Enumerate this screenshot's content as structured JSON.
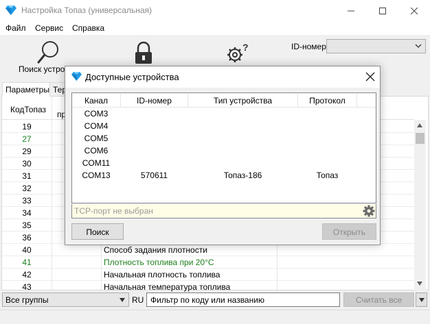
{
  "window": {
    "title": "Настройка Топаз (универсальная)",
    "controls": [
      "—",
      "☐",
      "✕"
    ]
  },
  "menu": [
    "Файл",
    "Сервис",
    "Справка"
  ],
  "toolbar": {
    "search_label": "Поиск устрой",
    "id_label": "ID-номер",
    "id_value": ""
  },
  "tabs": [
    "Параметры",
    "Тер"
  ],
  "grid": {
    "headers": [
      "КодТопаз",
      "пр"
    ],
    "rows": [
      {
        "code": "19",
        "name": "",
        "green": false
      },
      {
        "code": "27",
        "name": "",
        "green": true
      },
      {
        "code": "29",
        "name": "",
        "green": false
      },
      {
        "code": "30",
        "name": "",
        "green": false
      },
      {
        "code": "31",
        "name": "",
        "green": false
      },
      {
        "code": "32",
        "name": "",
        "green": false
      },
      {
        "code": "33",
        "name": "",
        "green": false
      },
      {
        "code": "34",
        "name": "",
        "green": false
      },
      {
        "code": "35",
        "name": "",
        "green": false
      },
      {
        "code": "36",
        "name": "",
        "green": false
      },
      {
        "code": "40",
        "name": "Способ задания плотности",
        "green": false
      },
      {
        "code": "41",
        "name": "Плотность топлива при 20°С",
        "green": true
      },
      {
        "code": "42",
        "name": "Начальная плотность топлива",
        "green": false
      },
      {
        "code": "43",
        "name": "Начальная температура топлива",
        "green": false
      }
    ]
  },
  "bottom": {
    "groups_value": "Все группы",
    "lang": "RU",
    "filter_placeholder": "Фильтр по коду или названию",
    "read_all_label": "Считать все"
  },
  "dialog": {
    "title": "Доступные устройства",
    "columns": [
      "Канал",
      "ID-номер",
      "Тип устройства",
      "Протокол"
    ],
    "rows": [
      {
        "channel": "COM3",
        "id": "",
        "type": "",
        "protocol": ""
      },
      {
        "channel": "COM4",
        "id": "",
        "type": "",
        "protocol": ""
      },
      {
        "channel": "COM5",
        "id": "",
        "type": "",
        "protocol": ""
      },
      {
        "channel": "COM6",
        "id": "",
        "type": "",
        "protocol": ""
      },
      {
        "channel": "COM11",
        "id": "",
        "type": "",
        "protocol": ""
      },
      {
        "channel": "COM13",
        "id": "570611",
        "type": "Топаз-186",
        "protocol": "Топаз"
      }
    ],
    "tcp_placeholder": "TCP-порт не выбран",
    "search_button": "Поиск",
    "open_button": "Открыть"
  },
  "colors": {
    "accent_green": "#1a7f1a",
    "icon_blue": "#1e9be6",
    "disabled_text": "#8a8a8a"
  }
}
